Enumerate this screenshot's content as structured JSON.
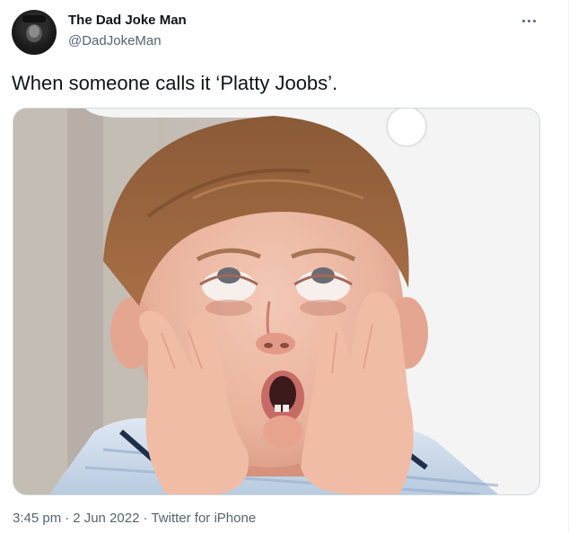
{
  "author": {
    "display_name": "The Dad Joke Man",
    "handle": "@DadJokeMan"
  },
  "tweet": {
    "text": "When someone calls it ‘Platty Joobs’."
  },
  "meta": {
    "time": "3:45 pm",
    "separator": "·",
    "date": "2 Jun 2022",
    "source": "Twitter for iPhone"
  },
  "icons": {
    "more": "more-horizontal-icon",
    "avatar": "avatar-image"
  },
  "colors": {
    "text_primary": "#0f1419",
    "text_secondary": "#536471",
    "border": "#cfd9de"
  }
}
